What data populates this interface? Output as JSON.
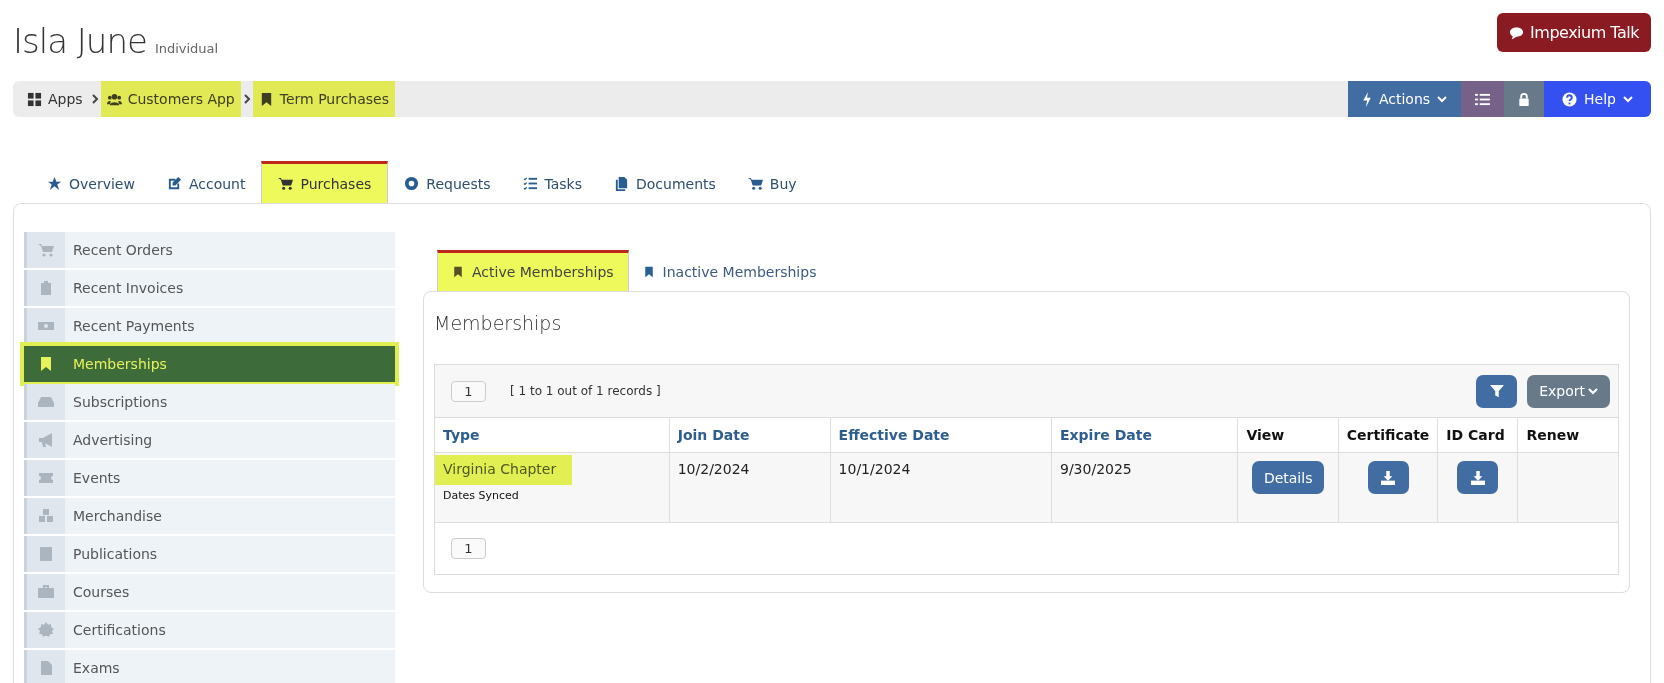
{
  "header": {
    "name": "Isla June",
    "type": "Individual",
    "talk_button": "Impexium Talk"
  },
  "breadcrumb": [
    {
      "label": "Apps",
      "highlighted": false
    },
    {
      "label": "Customers App",
      "highlighted": true
    },
    {
      "label": "Term Purchases",
      "highlighted": true
    }
  ],
  "toolbar": {
    "actions": "Actions",
    "help": "Help"
  },
  "tabs": [
    {
      "label": "Overview",
      "selected": false
    },
    {
      "label": "Account",
      "selected": false
    },
    {
      "label": "Purchases",
      "selected": true
    },
    {
      "label": "Requests",
      "selected": false
    },
    {
      "label": "Tasks",
      "selected": false
    },
    {
      "label": "Documents",
      "selected": false
    },
    {
      "label": "Buy",
      "selected": false
    }
  ],
  "sidebar": {
    "items": [
      {
        "label": "Recent Orders",
        "selected": false
      },
      {
        "label": "Recent Invoices",
        "selected": false
      },
      {
        "label": "Recent Payments",
        "selected": false
      },
      {
        "label": "Memberships",
        "selected": true
      },
      {
        "label": "Subscriptions",
        "selected": false
      },
      {
        "label": "Advertising",
        "selected": false
      },
      {
        "label": "Events",
        "selected": false
      },
      {
        "label": "Merchandise",
        "selected": false
      },
      {
        "label": "Publications",
        "selected": false
      },
      {
        "label": "Courses",
        "selected": false
      },
      {
        "label": "Certifications",
        "selected": false
      },
      {
        "label": "Exams",
        "selected": false
      }
    ]
  },
  "sub_tabs": [
    {
      "label": "Active Memberships",
      "selected": true
    },
    {
      "label": "Inactive Memberships",
      "selected": false
    }
  ],
  "panel": {
    "title": "Memberships",
    "page": "1",
    "records": "[ 1 to 1 out of 1 records ]",
    "export": "Export",
    "footer_page": "1"
  },
  "table": {
    "columns": [
      {
        "label": "Type",
        "sortable": true
      },
      {
        "label": "Join Date",
        "sortable": true
      },
      {
        "label": "Effective Date",
        "sortable": true
      },
      {
        "label": "Expire Date",
        "sortable": true
      },
      {
        "label": "View",
        "sortable": false
      },
      {
        "label": "Certificate",
        "sortable": false
      },
      {
        "label": "ID Card",
        "sortable": false
      },
      {
        "label": "Renew",
        "sortable": false
      }
    ],
    "rows": [
      {
        "type": "Virginia Chapter",
        "highlighted": true,
        "note": "Dates Synced",
        "join_date": "10/2/2024",
        "effective_date": "10/1/2024",
        "expire_date": "9/30/2025",
        "view": "Details"
      }
    ]
  }
}
